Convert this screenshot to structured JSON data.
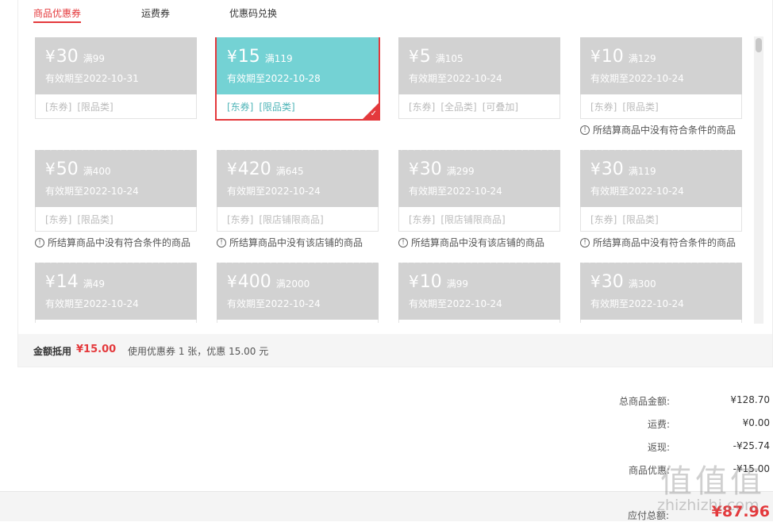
{
  "tabs": [
    {
      "label": "商品优惠券",
      "active": true
    },
    {
      "label": "运费券",
      "active": false
    },
    {
      "label": "优惠码兑换",
      "active": false
    }
  ],
  "coupons": [
    {
      "currency": "¥",
      "amount": "30",
      "condition": "满99",
      "expiry": "有效期至2022-10-31",
      "tags": [
        "[东券]",
        "[限品类]"
      ],
      "note": "",
      "selected": false
    },
    {
      "currency": "¥",
      "amount": "15",
      "condition": "满119",
      "expiry": "有效期至2022-10-28",
      "tags": [
        "[东券]",
        "[限品类]"
      ],
      "note": "",
      "selected": true
    },
    {
      "currency": "¥",
      "amount": "5",
      "condition": "满105",
      "expiry": "有效期至2022-10-24",
      "tags": [
        "[东券]",
        "[全品类]",
        "[可叠加]"
      ],
      "note": "",
      "selected": false
    },
    {
      "currency": "¥",
      "amount": "10",
      "condition": "满129",
      "expiry": "有效期至2022-10-24",
      "tags": [
        "[东券]",
        "[限品类]"
      ],
      "note": "所结算商品中没有符合条件的商品",
      "selected": false
    },
    {
      "currency": "¥",
      "amount": "50",
      "condition": "满400",
      "expiry": "有效期至2022-10-24",
      "tags": [
        "[东券]",
        "[限品类]"
      ],
      "note": "所结算商品中没有符合条件的商品",
      "selected": false
    },
    {
      "currency": "¥",
      "amount": "420",
      "condition": "满645",
      "expiry": "有效期至2022-10-24",
      "tags": [
        "[东券]",
        "[限店铺限商品]"
      ],
      "note": "所结算商品中没有该店铺的商品",
      "selected": false
    },
    {
      "currency": "¥",
      "amount": "30",
      "condition": "满299",
      "expiry": "有效期至2022-10-24",
      "tags": [
        "[东券]",
        "[限店铺限商品]"
      ],
      "note": "所结算商品中没有该店铺的商品",
      "selected": false
    },
    {
      "currency": "¥",
      "amount": "30",
      "condition": "满119",
      "expiry": "有效期至2022-10-24",
      "tags": [
        "[东券]",
        "[限品类]"
      ],
      "note": "所结算商品中没有符合条件的商品",
      "selected": false
    },
    {
      "currency": "¥",
      "amount": "14",
      "condition": "满49",
      "expiry": "有效期至2022-10-24",
      "tags": [],
      "note": "",
      "selected": false
    },
    {
      "currency": "¥",
      "amount": "400",
      "condition": "满2000",
      "expiry": "有效期至2022-10-24",
      "tags": [],
      "note": "",
      "selected": false
    },
    {
      "currency": "¥",
      "amount": "10",
      "condition": "满99",
      "expiry": "有效期至2022-10-24",
      "tags": [],
      "note": "",
      "selected": false
    },
    {
      "currency": "¥",
      "amount": "30",
      "condition": "满300",
      "expiry": "有效期至2022-10-24",
      "tags": [],
      "note": "",
      "selected": false
    }
  ],
  "summary": {
    "label": "金额抵用",
    "amount": "¥15.00",
    "description": "使用优惠券 1 张，优惠 15.00 元"
  },
  "totals": [
    {
      "label": "总商品金额:",
      "value": "¥128.70"
    },
    {
      "label": "运费:",
      "value": "¥0.00"
    },
    {
      "label": "返现:",
      "value": "-¥25.74"
    },
    {
      "label": "商品优惠:",
      "value": "-¥15.00"
    }
  ],
  "payable": {
    "label": "应付总额:",
    "value": "¥87.96"
  },
  "colors": {
    "accent": "#e4393c",
    "selected_coupon": "#74d2d4",
    "disabled_coupon": "#d2d2d2"
  },
  "watermark": {
    "logo": "值值值",
    "text": "zhizhizhi.com"
  }
}
